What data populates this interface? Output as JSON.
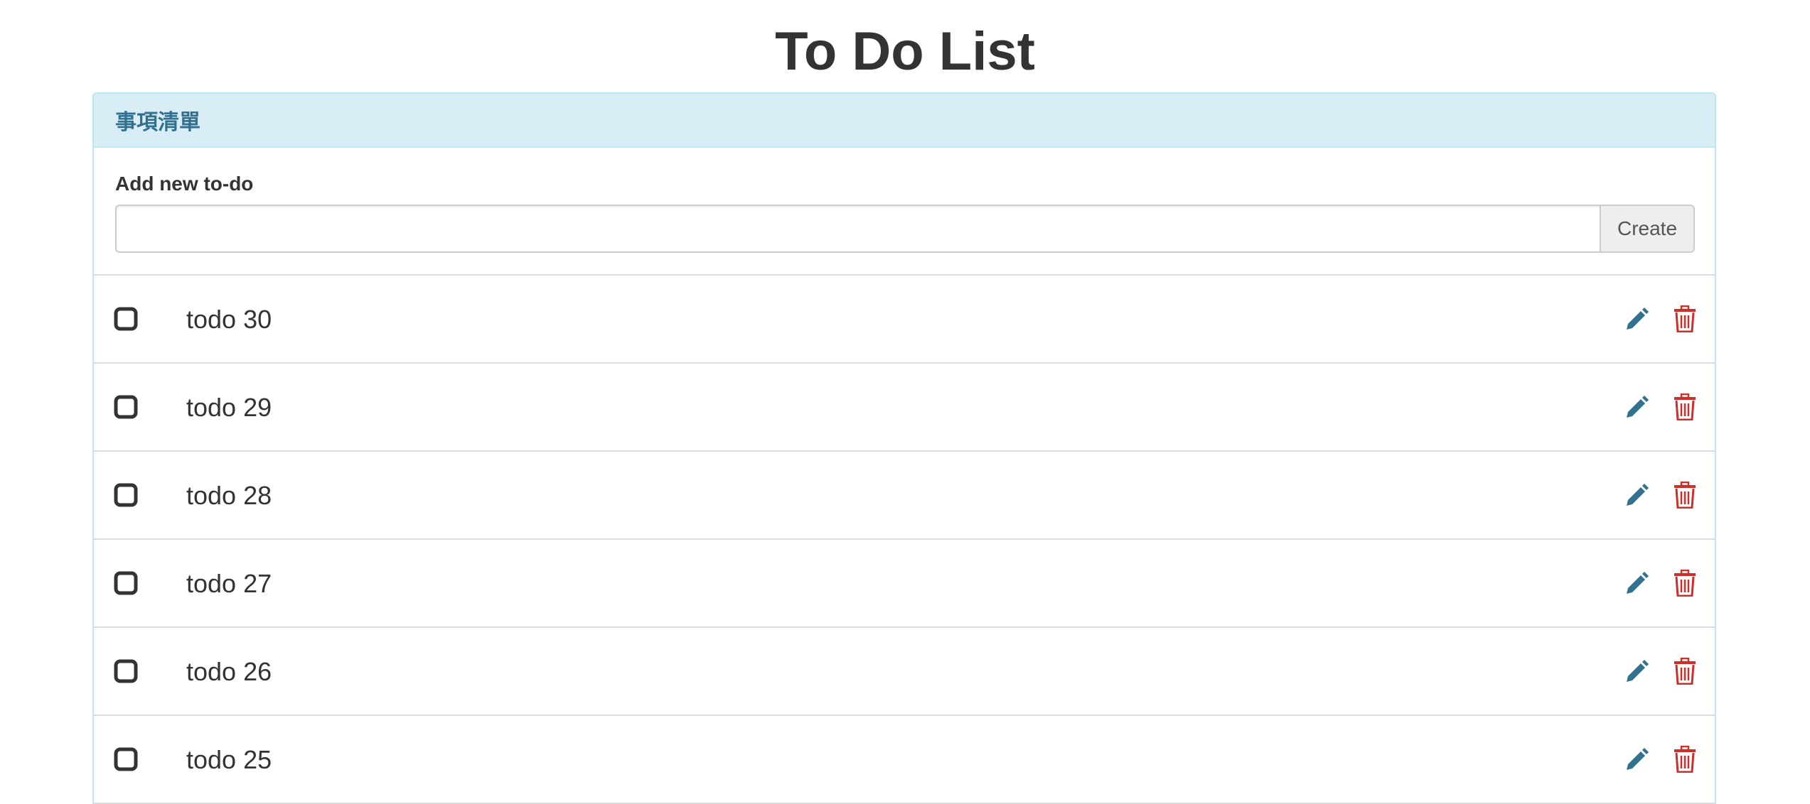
{
  "page": {
    "title": "To Do List"
  },
  "panel": {
    "heading": "事項清單"
  },
  "add_form": {
    "label": "Add new to-do",
    "input_value": "",
    "placeholder": "",
    "create_label": "Create"
  },
  "todos": [
    {
      "text": "todo 30",
      "checked": false
    },
    {
      "text": "todo 29",
      "checked": false
    },
    {
      "text": "todo 28",
      "checked": false
    },
    {
      "text": "todo 27",
      "checked": false
    },
    {
      "text": "todo 26",
      "checked": false
    },
    {
      "text": "todo 25",
      "checked": false
    }
  ],
  "icons": {
    "checkbox": "unchecked-square-icon",
    "edit": "pencil-icon",
    "delete": "trash-icon"
  },
  "colors": {
    "panel_heading_bg": "#d9edf7",
    "panel_heading_text": "#31708f",
    "panel_border": "#bce8f1",
    "edit_icon": "#31708f",
    "delete_icon": "#c9302c"
  }
}
